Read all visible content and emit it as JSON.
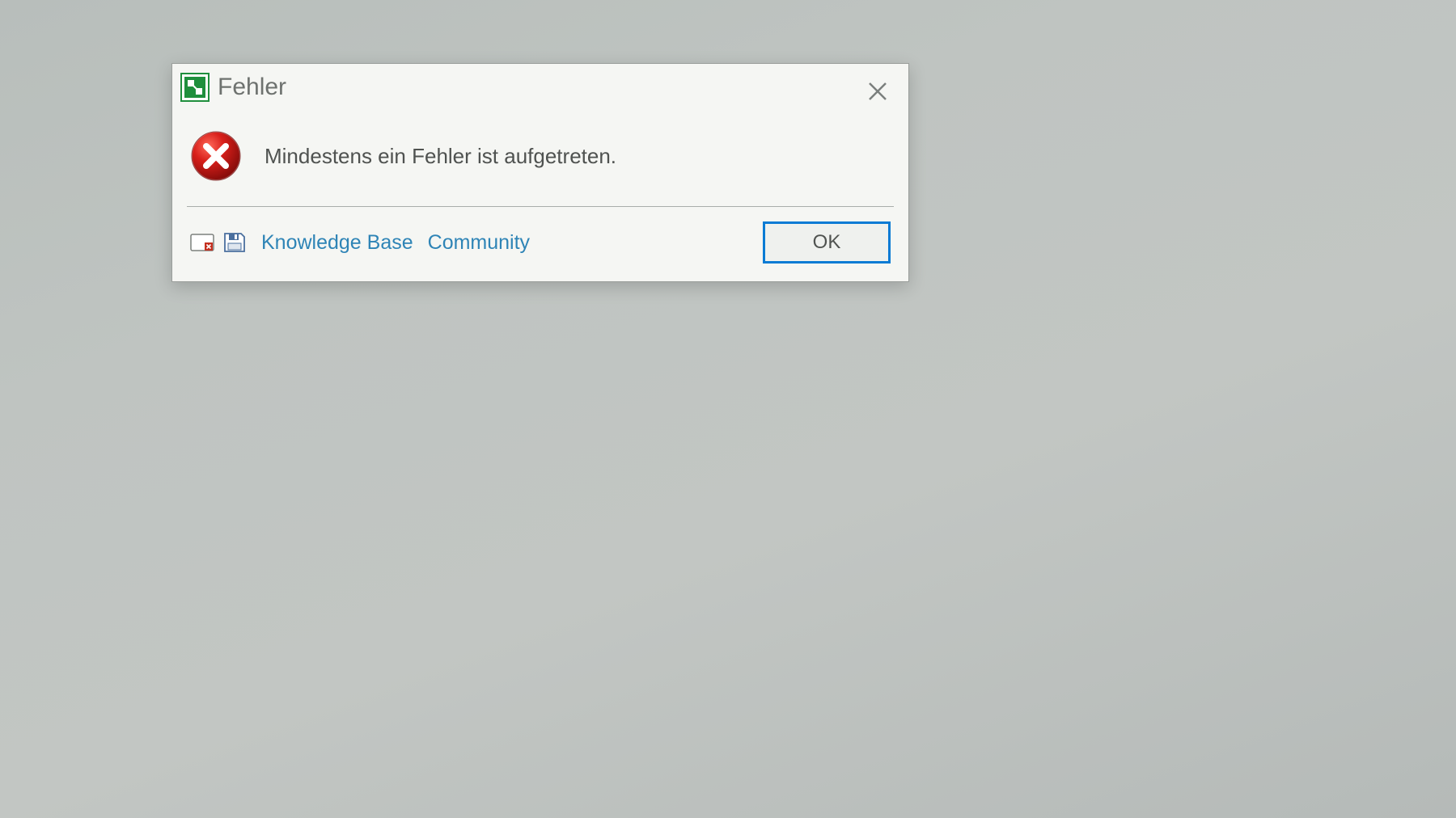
{
  "dialog": {
    "title": "Fehler",
    "message": "Mindestens ein Fehler ist aufgetreten.",
    "links": {
      "knowledge_base": "Knowledge Base",
      "community": "Community"
    },
    "ok_button": "OK"
  }
}
